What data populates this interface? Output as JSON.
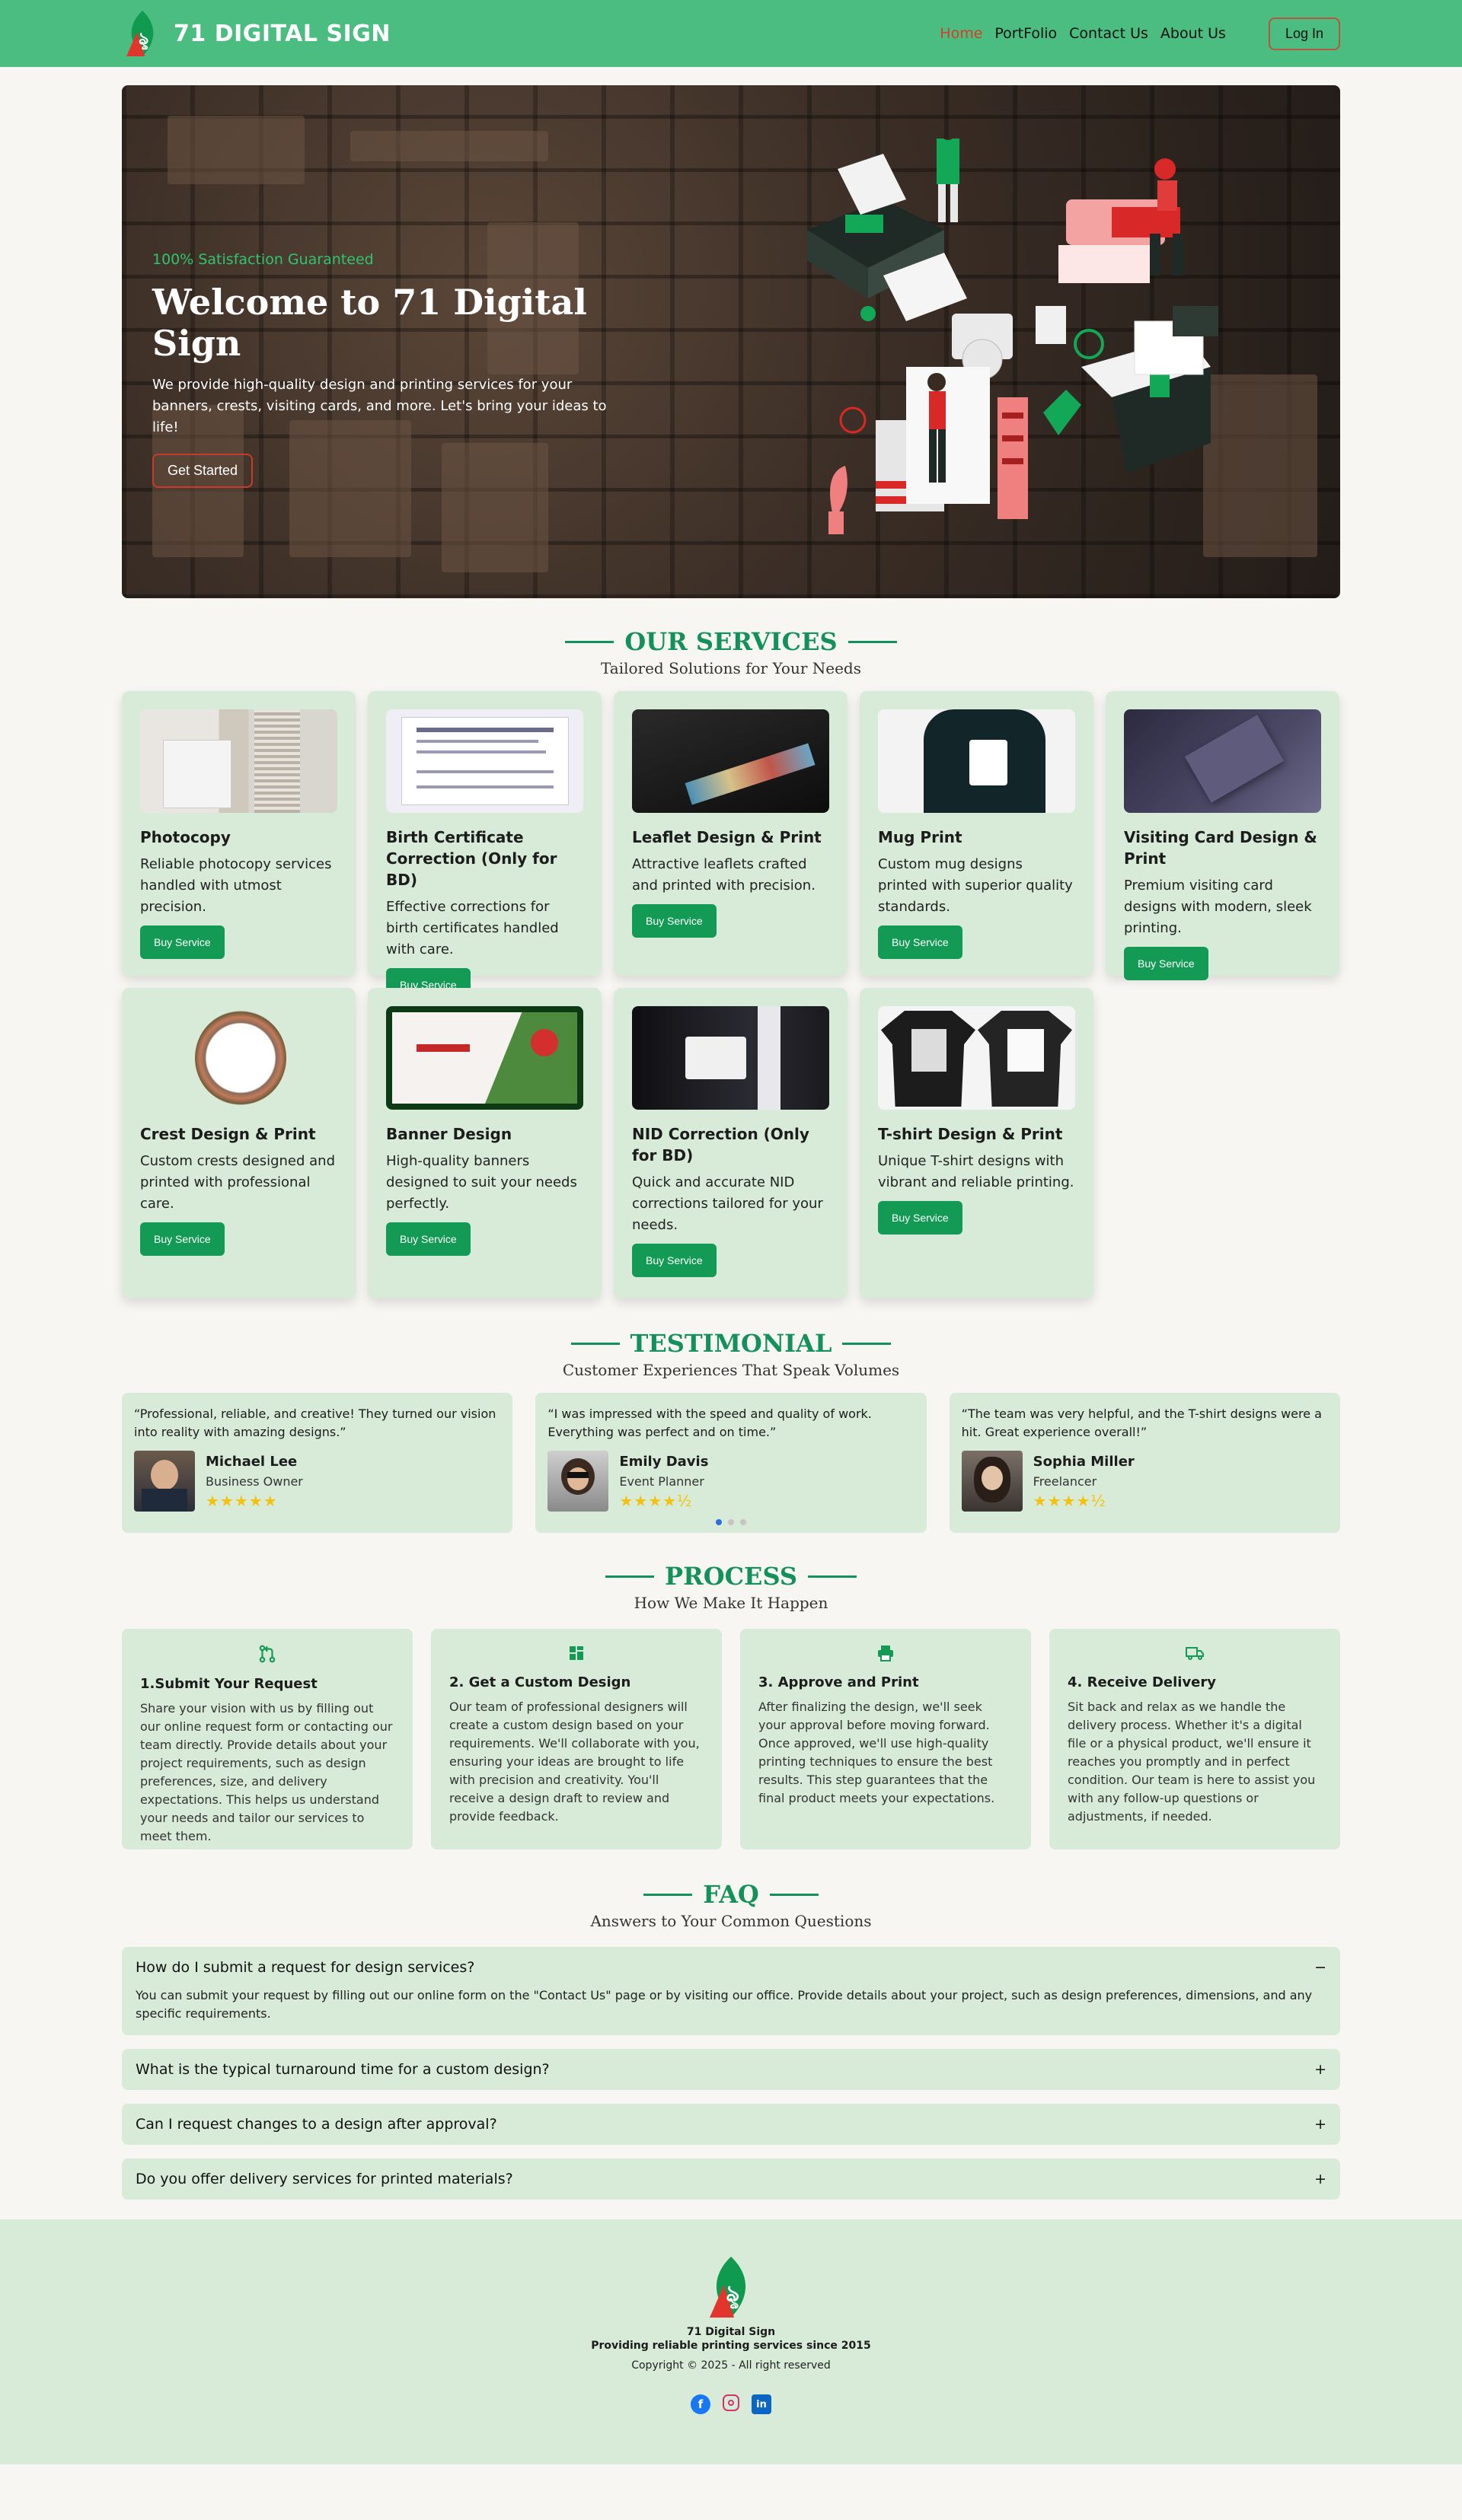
{
  "header": {
    "brand": "71 DIGITAL SIGN",
    "nav": [
      "Home",
      "PortFolio",
      "Contact Us",
      "About Us"
    ],
    "login": "Log In"
  },
  "hero": {
    "tag": "100% Satisfaction Guaranteed",
    "title": "Welcome to 71 Digital Sign",
    "description": "We provide high-quality design and printing services for your banners, crests, visiting cards, and more. Let's bring your ideas to life!",
    "button": "Get Started"
  },
  "services": {
    "title": "OUR SERVICES",
    "subtitle": "Tailored Solutions for Your Needs",
    "button": "Buy Service",
    "items": [
      {
        "name": "Photocopy",
        "desc": "Reliable photocopy services handled with utmost precision."
      },
      {
        "name": "Birth Certificate Correction (Only for BD)",
        "desc": "Effective corrections for birth certificates handled with care."
      },
      {
        "name": "Leaflet Design & Print",
        "desc": "Attractive leaflets crafted and printed with precision."
      },
      {
        "name": "Mug Print",
        "desc": "Custom mug designs printed with superior quality standards."
      },
      {
        "name": "Visiting Card Design & Print",
        "desc": "Premium visiting card designs with modern, sleek printing."
      },
      {
        "name": "Crest Design & Print",
        "desc": "Custom crests designed and printed with professional care."
      },
      {
        "name": "Banner Design",
        "desc": "High-quality banners designed to suit your needs perfectly."
      },
      {
        "name": "NID Correction (Only for BD)",
        "desc": "Quick and accurate NID corrections tailored for your needs."
      },
      {
        "name": "T-shirt Design & Print",
        "desc": "Unique T-shirt designs with vibrant and reliable printing."
      }
    ]
  },
  "testimonial": {
    "title": "TESTIMONIAL",
    "subtitle": "Customer Experiences That Speak Volumes",
    "items": [
      {
        "quote": "“Professional, reliable, and creative! They turned our vision into reality with amazing designs.”",
        "name": "Michael Lee",
        "role": "Business Owner",
        "stars": "★★★★★"
      },
      {
        "quote": "“I was impressed with the speed and quality of work. Everything was perfect and on time.”",
        "name": "Emily Davis",
        "role": "Event Planner",
        "stars": "★★★★½"
      },
      {
        "quote": "“The team was very helpful, and the T-shirt designs were a hit. Great experience overall!”",
        "name": "Sophia Miller",
        "role": "Freelancer",
        "stars": "★★★★½"
      }
    ]
  },
  "process": {
    "title": "PROCESS",
    "subtitle": "How We Make It Happen",
    "steps": [
      {
        "title": "1.Submit Your Request",
        "desc": "Share your vision with us by filling out our online request form or contacting our team directly. Provide details about your project requirements, such as design preferences, size, and delivery expectations. This helps us understand your needs and tailor our services to meet them."
      },
      {
        "title": "2. Get a Custom Design",
        "desc": "Our team of professional designers will create a custom design based on your requirements. We'll collaborate with you, ensuring your ideas are brought to life with precision and creativity. You'll receive a design draft to review and provide feedback."
      },
      {
        "title": "3. Approve and Print",
        "desc": "After finalizing the design, we'll seek your approval before moving forward. Once approved, we'll use high-quality printing techniques to ensure the best results. This step guarantees that the final product meets your expectations."
      },
      {
        "title": "4. Receive Delivery",
        "desc": "Sit back and relax as we handle the delivery process. Whether it's a digital file or a physical product, we'll ensure it reaches you promptly and in perfect condition. Our team is here to assist you with any follow-up questions or adjustments, if needed."
      }
    ]
  },
  "faq": {
    "title": "FAQ",
    "subtitle": "Answers to Your Common Questions",
    "items": [
      {
        "q": "How do I submit a request for design services?",
        "a": "You can submit your request by filling out our online form on the \"Contact Us\" page or by visiting our office. Provide details about your project, such as design preferences, dimensions, and any specific requirements.",
        "toggle": "−"
      },
      {
        "q": "What is the typical turnaround time for a custom design?",
        "toggle": "+"
      },
      {
        "q": "Can I request changes to a design after approval?",
        "toggle": "+"
      },
      {
        "q": "Do you offer delivery services for printed materials?",
        "toggle": "+"
      }
    ]
  },
  "footer": {
    "name": "71 Digital Sign",
    "tagline": "Providing reliable printing services since 2015",
    "copyright": "Copyright © 2025 - All right reserved"
  },
  "colors": {
    "primary": "#4bbd80",
    "accent": "#139a55",
    "card": "#d8ead8",
    "active": "#d63d2a"
  }
}
